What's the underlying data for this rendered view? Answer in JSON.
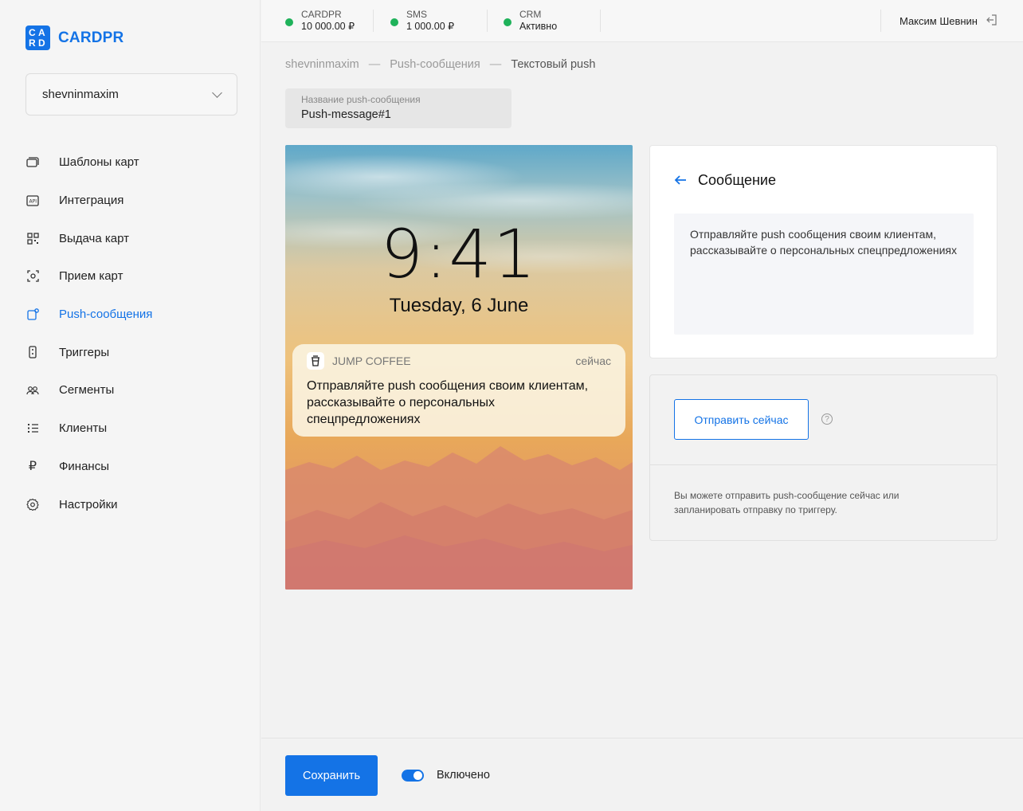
{
  "brand": {
    "name": "CARDPR",
    "accent": "#1473e6",
    "logo_letters": [
      "C",
      "A",
      "R",
      "D"
    ]
  },
  "account": {
    "selected": "shevninmaxim"
  },
  "nav": [
    {
      "label": "Шаблоны карт",
      "icon": "card-template-icon"
    },
    {
      "label": "Интеграция",
      "icon": "api-icon"
    },
    {
      "label": "Выдача карт",
      "icon": "qr-code-icon"
    },
    {
      "label": "Прием карт",
      "icon": "scan-icon"
    },
    {
      "label": "Push-сообщения",
      "icon": "push-icon",
      "active": true
    },
    {
      "label": "Триггеры",
      "icon": "trigger-icon"
    },
    {
      "label": "Сегменты",
      "icon": "segments-icon"
    },
    {
      "label": "Клиенты",
      "icon": "clients-list-icon"
    },
    {
      "label": "Финансы",
      "icon": "ruble-icon"
    },
    {
      "label": "Настройки",
      "icon": "settings-gear-icon"
    }
  ],
  "topbar": {
    "stats": [
      {
        "label": "CARDPR",
        "value": "10 000.00 ₽",
        "status_color": "#1fb25a"
      },
      {
        "label": "SMS",
        "value": "1 000.00 ₽",
        "status_color": "#1fb25a"
      },
      {
        "label": "CRM",
        "value": "Активно",
        "status_color": "#1fb25a"
      }
    ],
    "user_name": "Максим Шевнин"
  },
  "breadcrumb": {
    "items": [
      "shevninmaxim",
      "Push-сообщения"
    ],
    "current": "Текстовый push",
    "separator": "—"
  },
  "name_field": {
    "label": "Название push-сообщения",
    "value": "Push-message#1"
  },
  "preview": {
    "time": "9:41",
    "date": "Tuesday, 6 June",
    "notification": {
      "app": "JUMP COFFEE",
      "when": "сейчас",
      "text": "Отправляйте push сообщения своим клиентам, рассказывайте о персональных спецпредложениях"
    }
  },
  "message_card": {
    "title": "Сообщение",
    "text": "Отправляйте push сообщения своим клиентам, рассказывайте о персональных спецпредложениях"
  },
  "send_card": {
    "button": "Отправить сейчас",
    "help": "?",
    "note": "Вы можете отправить push-сообщение сейчас или запланировать отправку по триггеру."
  },
  "footer": {
    "save": "Сохранить",
    "toggle_label": "Включено",
    "toggle_on": true
  }
}
